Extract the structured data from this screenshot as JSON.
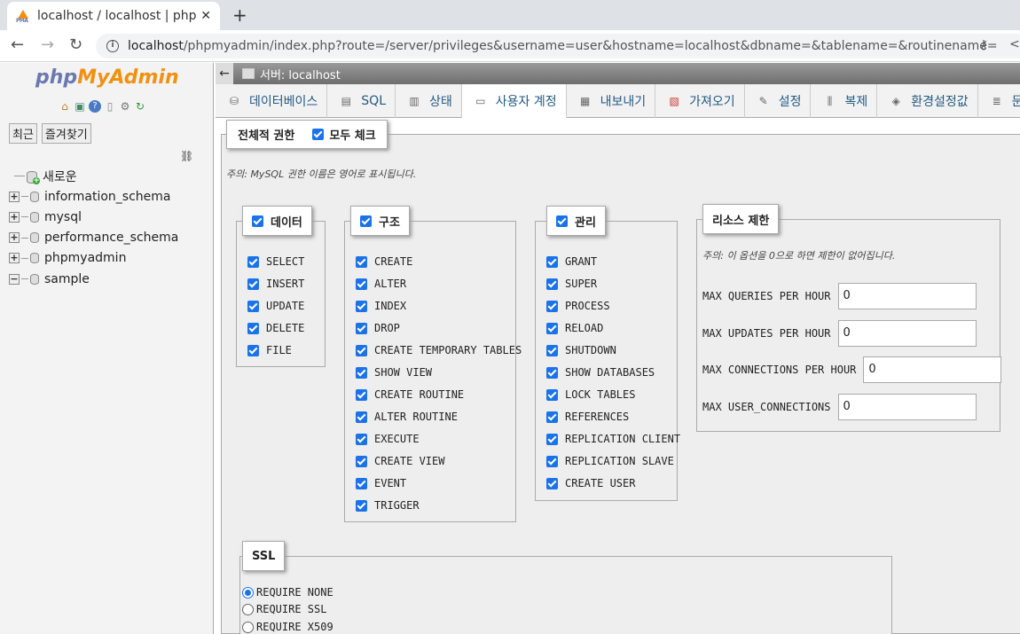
{
  "browser": {
    "tab_title": "localhost / localhost | phpMyAdmin",
    "new_tab": "+",
    "close": "✕",
    "url_host": "localhost",
    "url_path": "/phpmyadmin/index.php?route=/server/privileges&username=user&hostname=localhost&dbname=&tablename=&routinename="
  },
  "sidebar": {
    "logo_php": "php",
    "logo_my": "My",
    "logo_admin": "Admin",
    "recent_label": "최근",
    "favorites_label": "즐겨찾기",
    "new_label": "새로운",
    "databases": [
      "information_schema",
      "mysql",
      "performance_schema",
      "phpmyadmin",
      "sample"
    ]
  },
  "server_bar": {
    "label": "서버: localhost"
  },
  "menu": {
    "items": [
      "데이터베이스",
      "SQL",
      "상태",
      "사용자 계정",
      "내보내기",
      "가져오기",
      "설정",
      "복제",
      "환경설정값",
      "문자셋"
    ],
    "active_index": 3
  },
  "privileges": {
    "global_label": "전체적 권한",
    "check_all_label": "모두 체크",
    "note": "주의: MySQL 권한 이름은 영어로 표시됩니다.",
    "data": {
      "title": "데이터",
      "items": [
        "SELECT",
        "INSERT",
        "UPDATE",
        "DELETE",
        "FILE"
      ]
    },
    "structure": {
      "title": "구조",
      "items": [
        "CREATE",
        "ALTER",
        "INDEX",
        "DROP",
        "CREATE TEMPORARY TABLES",
        "SHOW VIEW",
        "CREATE ROUTINE",
        "ALTER ROUTINE",
        "EXECUTE",
        "CREATE VIEW",
        "EVENT",
        "TRIGGER"
      ]
    },
    "admin": {
      "title": "관리",
      "items": [
        "GRANT",
        "SUPER",
        "PROCESS",
        "RELOAD",
        "SHUTDOWN",
        "SHOW DATABASES",
        "LOCK TABLES",
        "REFERENCES",
        "REPLICATION CLIENT",
        "REPLICATION SLAVE",
        "CREATE USER"
      ]
    },
    "limits": {
      "title": "리소스 제한",
      "note": "주의: 이 옵션을 0으로 하면 제한이 없어집니다.",
      "items": [
        {
          "label": "MAX QUERIES PER HOUR",
          "value": "0"
        },
        {
          "label": "MAX UPDATES PER HOUR",
          "value": "0"
        },
        {
          "label": "MAX CONNECTIONS PER HOUR",
          "value": "0"
        },
        {
          "label": "MAX USER_CONNECTIONS",
          "value": "0"
        }
      ]
    },
    "ssl": {
      "title": "SSL",
      "options": [
        "REQUIRE NONE",
        "REQUIRE SSL",
        "REQUIRE X509"
      ],
      "selected_index": 0
    }
  },
  "colors": {
    "accent": "#1a73e8",
    "link": "#235a81",
    "logo_blue": "#6c78af",
    "logo_orange": "#f29111"
  }
}
